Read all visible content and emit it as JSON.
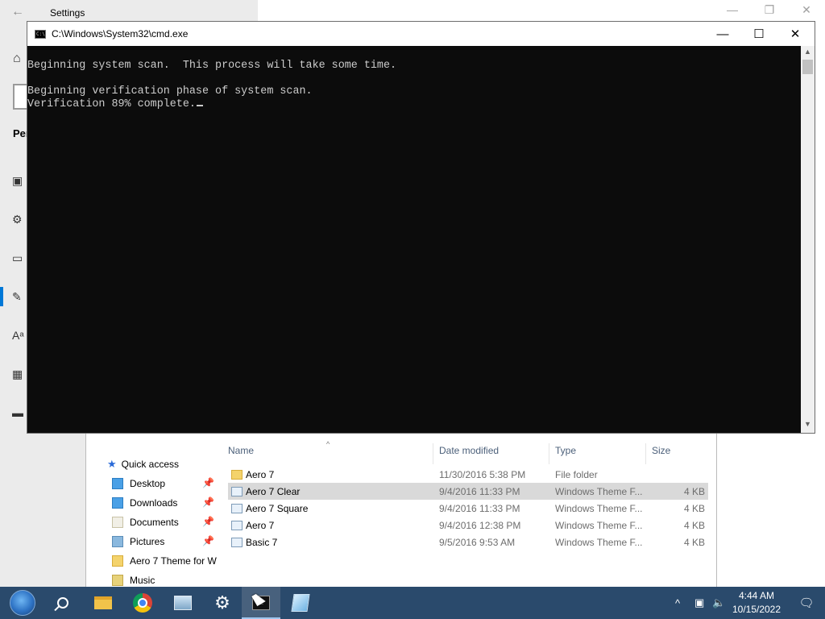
{
  "settings": {
    "title": "Settings",
    "back_icon": "arrow-left-icon",
    "section_label": "Per",
    "nav_icons": [
      "home-icon",
      "picture-icon",
      "palette-icon",
      "monitor-icon",
      "pen-screen-icon",
      "font-icon",
      "start-icon",
      "taskbar-icon"
    ],
    "accent_color": "#0078d7"
  },
  "cmd": {
    "title": "C:\\Windows\\System32\\cmd.exe",
    "lines": [
      "Beginning system scan.  This process will take some time.",
      "",
      "Beginning verification phase of system scan.",
      "Verification 89% complete."
    ],
    "background": "#0c0c0c",
    "text_color": "#cccccc"
  },
  "explorer": {
    "nav": {
      "quick_access": "Quick access",
      "items": [
        {
          "label": "Desktop",
          "icon": "desktop-folder-icon",
          "pinned": true
        },
        {
          "label": "Downloads",
          "icon": "downloads-folder-icon",
          "pinned": true
        },
        {
          "label": "Documents",
          "icon": "documents-folder-icon",
          "pinned": true
        },
        {
          "label": "Pictures",
          "icon": "pictures-folder-icon",
          "pinned": true
        },
        {
          "label": "Aero 7 Theme for W",
          "icon": "folder-icon",
          "pinned": false
        },
        {
          "label": "Music",
          "icon": "music-folder-icon",
          "pinned": false
        }
      ]
    },
    "columns": [
      "Name",
      "Date modified",
      "Type",
      "Size"
    ],
    "rows": [
      {
        "name": "Aero 7",
        "date": "11/30/2016 5:38 PM",
        "type": "File folder",
        "size": "",
        "icon": "folder"
      },
      {
        "name": "Aero 7 Clear",
        "date": "9/4/2016 11:33 PM",
        "type": "Windows Theme F...",
        "size": "4 KB",
        "icon": "theme",
        "selected": true
      },
      {
        "name": "Aero 7 Square",
        "date": "9/4/2016 11:33 PM",
        "type": "Windows Theme F...",
        "size": "4 KB",
        "icon": "theme"
      },
      {
        "name": "Aero 7",
        "date": "9/4/2016 12:38 PM",
        "type": "Windows Theme F...",
        "size": "4 KB",
        "icon": "theme"
      },
      {
        "name": "Basic 7",
        "date": "9/5/2016 9:53 AM",
        "type": "Windows Theme F...",
        "size": "4 KB",
        "icon": "theme"
      }
    ]
  },
  "taskbar": {
    "apps": [
      "start-orb-icon",
      "search-icon",
      "file-explorer-icon",
      "chrome-icon",
      "image-viewer-icon",
      "settings-gear-icon",
      "cmd-icon",
      "theme-app-icon"
    ],
    "active_app": "cmd-icon",
    "tray": {
      "chevron": "^",
      "time": "4:44 AM",
      "date": "10/15/2022"
    },
    "color": "#2a4a6c"
  }
}
